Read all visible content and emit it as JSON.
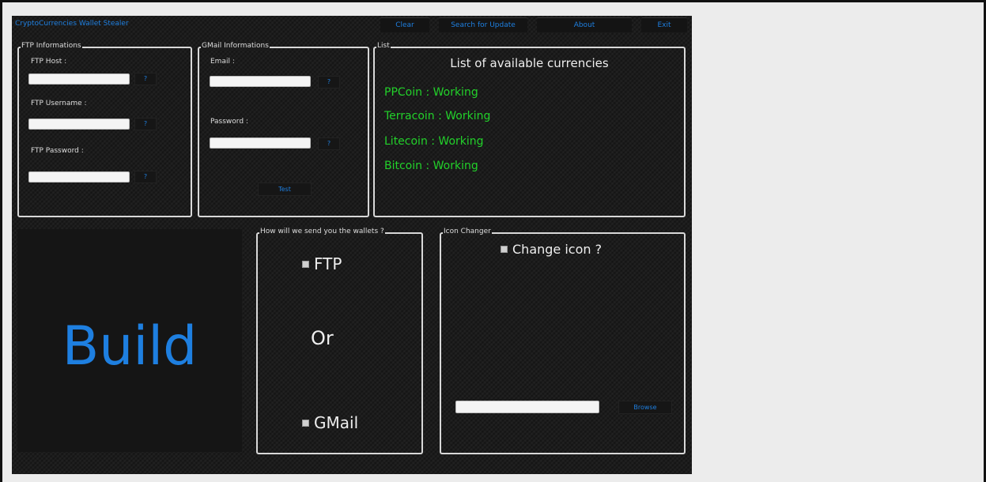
{
  "app": {
    "title": "CryptoCurrencies Wallet Stealer"
  },
  "menu": {
    "clear": "Clear",
    "search_update": "Search for Update",
    "about": "About",
    "exit": "Exit"
  },
  "ftp": {
    "group_label": "FTP Informations",
    "host_label": "FTP Host :",
    "username_label": "FTP Username :",
    "password_label": "FTP Password :",
    "host_value": "",
    "username_value": "",
    "password_value": "",
    "help_label": "?"
  },
  "gmail": {
    "group_label": "GMail Informations",
    "email_label": "Email :",
    "password_label": "Password :",
    "email_value": "",
    "password_value": "",
    "help_label": "?",
    "test_label": "Test"
  },
  "list": {
    "group_label": "List",
    "title": "List of available currencies",
    "items": [
      "PPCoin : Working",
      "Terracoin : Working",
      "Litecoin : Working",
      "Bitcoin : Working"
    ]
  },
  "build": {
    "label": "Build"
  },
  "send_method": {
    "group_label": "How will we send you the wallets ?",
    "ftp_label": "FTP",
    "or_label": "Or",
    "gmail_label": "GMail"
  },
  "icon_changer": {
    "group_label": "Icon Changer",
    "checkbox_label": "Change icon ?",
    "path_value": "",
    "browse_label": "Browse"
  },
  "colors": {
    "accent": "#1e7fe0",
    "status_ok": "#22d12a",
    "window_bg": "#1c1c1c"
  }
}
